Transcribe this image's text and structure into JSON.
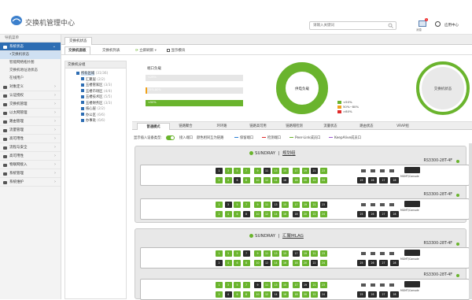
{
  "header": {
    "title": "交换机管理中心",
    "search_placeholder": "请输入关键词",
    "msg_count": "1",
    "msg_label": "消息",
    "app_center": "应用中心"
  },
  "sidebar": {
    "nav_title": "导航菜单",
    "items": [
      {
        "label": "系统状态",
        "active": true
      },
      {
        "label": "对象定义"
      },
      {
        "label": "认证授权"
      },
      {
        "label": "交换机管理"
      },
      {
        "label": "以太网管理"
      },
      {
        "label": "路由管理"
      },
      {
        "label": "流量管理"
      },
      {
        "label": "高可用性"
      },
      {
        "label": "流程与安全"
      },
      {
        "label": "高可用性"
      },
      {
        "label": "物联网接入"
      },
      {
        "label": "系统管理"
      },
      {
        "label": "系统维护"
      }
    ],
    "sub_items": [
      "•交换机状态",
      "智能网络拓扑图",
      "交换机地址池状态",
      "在线用户"
    ]
  },
  "tabbar": {
    "active": "交换机状态"
  },
  "subtabs": {
    "overview": "交换机面板",
    "list": "交换机列表",
    "refresh": "立即刷新",
    "show_mode": "显示模块"
  },
  "tree": {
    "header": "交换机分组",
    "nodes": [
      {
        "label": "所有区域",
        "count": "(31/36)",
        "level": 0,
        "selected": true
      },
      {
        "label": "汇聚层",
        "count": "(2/2)",
        "level": 1
      },
      {
        "label": "五楼管家区",
        "count": "(3/3)",
        "level": 1
      },
      {
        "label": "五楼市场区",
        "count": "(4/4)",
        "level": 1
      },
      {
        "label": "五楼技术区",
        "count": "(5/5)",
        "level": 1
      },
      {
        "label": "五楼财务区",
        "count": "(3/3)",
        "level": 1
      },
      {
        "label": "核心层",
        "count": "(2/2)",
        "level": 1
      },
      {
        "label": "办公区",
        "count": "(6/6)",
        "level": 1
      },
      {
        "label": "办事处",
        "count": "(6/6)",
        "level": 1
      }
    ]
  },
  "load_panel": {
    "title": "端口负载",
    "bars": [
      {
        "label": "<25%",
        "value": 0.02,
        "color": "#e6e6e6"
      },
      {
        "label": "25%-80%",
        "value": 0.02,
        "color": "#f0a21a"
      },
      {
        "label": "<50%",
        "value": 1.0,
        "color": "#6ab42d"
      }
    ],
    "donut_label": "供电负载",
    "legend": [
      {
        "label": "<50%",
        "color": "#6ab42d"
      },
      {
        "label": "50%~80%",
        "color": "#f0a21a"
      },
      {
        "label": ">80%",
        "color": "#e02a2a"
      }
    ],
    "status_label": "交换机状态"
  },
  "tabs2": [
    "普通模式",
    "链路聚合",
    "环环路",
    "链路高可用",
    "链路帽检测",
    "流量状态",
    "路由状态",
    "VRAP组"
  ],
  "opts": {
    "show_type": "显示插入设备类型:",
    "access": "接入端口",
    "color_note": "颜色相同互为链路",
    "pr": "保留端口",
    "mon": "检测端口",
    "peer": "Peer-Link成员口",
    "keep": "KeepAlive成员口",
    "colors": {
      "pr": "#2a7fd4",
      "mon": "#e02a2a",
      "peer": "#6ab42d",
      "keep": "#9b59d0"
    }
  },
  "devices": [
    {
      "brand": "SUNDRAY",
      "group": "规划组",
      "switches": [
        "RS3300-28T-4F",
        "RS3300-28T-4F"
      ]
    },
    {
      "brand": "SUNDRAY",
      "group": "汇聚MLAG",
      "switches": [
        "RS3300-28T-4F",
        "RS3300-28T-4F"
      ]
    }
  ],
  "ports": {
    "top": [
      "1",
      "2",
      "3",
      "4",
      "5",
      "6",
      "7",
      "8",
      "9",
      "10",
      "11",
      "12",
      "13",
      "14",
      "15",
      "16",
      "17",
      "18",
      "19",
      "20",
      "21",
      "22",
      "23",
      "24"
    ],
    "bottom": [
      "25",
      "26",
      "27",
      "28"
    ],
    "console": "MGMT/Console"
  }
}
